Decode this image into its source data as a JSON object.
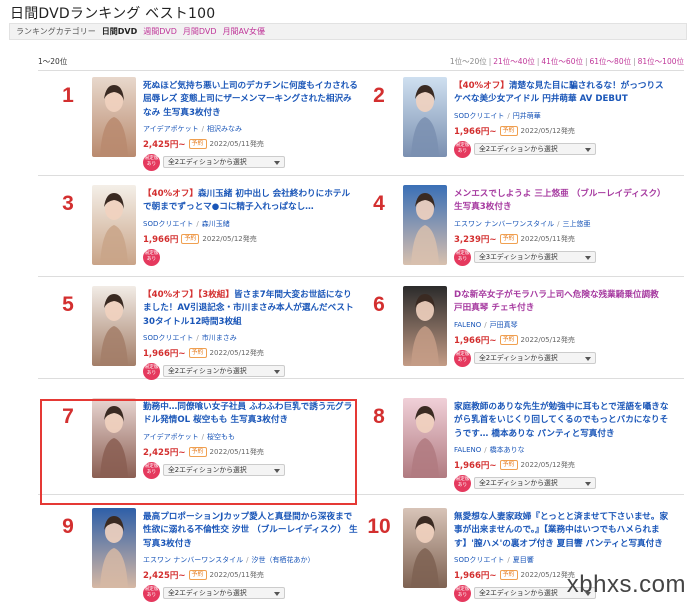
{
  "page": {
    "title": "日間DVDランキング ベスト100",
    "watermark": "xbhxs.com"
  },
  "categories": {
    "label": "ランキングカテゴリー",
    "active": "日間DVD",
    "links": [
      "週間DVD",
      "月間DVD",
      "月間AV女優"
    ]
  },
  "ranges": {
    "current": "1〜20位",
    "links": [
      "1位〜20位",
      "21位〜40位",
      "41位〜60位",
      "61位〜80位",
      "81位〜100位"
    ]
  },
  "common": {
    "edition_label": "全2エディションから選択",
    "edition_label_3": "全3エディションから選択",
    "badge": "限定版あり",
    "yoyaku": "予約"
  },
  "items": [
    {
      "rank": "1",
      "discount": "",
      "title": "死ぬほど気持ち悪い上司のデカチンに何度もイカされる屈辱レズ 変態上司にザーメンマーキングされた相沢みなみ 生写真3枚付き",
      "maker": "アイデアポケット",
      "actress": "相沢みなみ",
      "price": "2,425円~",
      "release": "2022/05/11発売",
      "edition": "全2エディションから選択",
      "cover_colors": [
        "#e8d8cc",
        "#b98a6e"
      ]
    },
    {
      "rank": "2",
      "discount": "【40%オフ】",
      "title": "清楚な見た目に騙されるな！がっつりスケベな美少女アイドル 円井萌華 AV DEBUT",
      "maker": "SODクリエイト",
      "actress": "円井萌華",
      "price": "1,966円~",
      "release": "2022/05/12発売",
      "edition": "全2エディションから選択",
      "cover_colors": [
        "#cfe0f0",
        "#7a8fb0"
      ]
    },
    {
      "rank": "3",
      "discount": "【40%オフ】",
      "title": "森川玉緒 初中出し 会社終わりにホテルで朝までずっとマ●コに精子入れっぱなし…",
      "maker": "SODクリエイト",
      "actress": "森川玉緒",
      "price": "1,966円",
      "release": "2022/05/12発売",
      "edition": "",
      "cover_colors": [
        "#f4efe8",
        "#c9a488"
      ]
    },
    {
      "rank": "4",
      "discount": "",
      "title": "メンエスでしようよ 三上悠亜 （ブルーレイディスク） 生写真3枚付き",
      "maker": "エスワン ナンバーワンスタイル",
      "actress": "三上悠亜",
      "price": "3,239円~",
      "release": "2022/05/11発売",
      "edition": "全3エディションから選択",
      "cover_colors": [
        "#3a6fb6",
        "#d8c0ae"
      ]
    },
    {
      "rank": "5",
      "discount": "【40%オフ】【3枚組】",
      "title": "皆さま7年間大変お世話になりました！AV引退記念・市川まさみ本人が選んだベスト30タイトル12時間3枚組",
      "maker": "SODクリエイト",
      "actress": "市川まさみ",
      "price": "1,966円~",
      "release": "2022/05/12発売",
      "edition": "全2エディションから選択",
      "cover_colors": [
        "#f2ece6",
        "#a37e68"
      ]
    },
    {
      "rank": "6",
      "discount": "",
      "title": "Dな新卒女子がモラハラ上司へ危険な残業騎乗位調教 戸田真琴 チェキ付き",
      "maker": "FALENO",
      "actress": "戸田真琴",
      "price": "1,966円~",
      "release": "2022/05/12発売",
      "edition": "全2エディションから選択",
      "cover_colors": [
        "#2b2b2b",
        "#c49c86"
      ]
    },
    {
      "rank": "7",
      "discount": "",
      "title": "勤務中…同僚喰い女子社員 ふわふわ巨乳で誘う元グラドル発情OL 桜空もも 生写真3枚付き",
      "maker": "アイデアポケット",
      "actress": "桜空もも",
      "price": "2,425円~",
      "release": "2022/05/11発売",
      "edition": "全2エディションから選択",
      "cover_colors": [
        "#e9d6d2",
        "#8a5e52"
      ]
    },
    {
      "rank": "8",
      "discount": "",
      "title": "家庭教師のありな先生が勉強中に耳もとで淫語を囁きながら乳首をいじくり回してくるのでもっとバカになりそうです… 橋本ありな パンティと写真付き",
      "maker": "FALENO",
      "actress": "橋本ありな",
      "price": "1,966円~",
      "release": "2022/05/12発売",
      "edition": "全2エディションから選択",
      "cover_colors": [
        "#f0d0d8",
        "#b07a80"
      ]
    },
    {
      "rank": "9",
      "discount": "",
      "title": "最高プロポーションJカップ愛人と真昼間から深夜まで性欲に溺れる不倫性交 汐世 （ブルーレイディスク） 生写真3枚付き",
      "maker": "エスワン ナンバーワンスタイル",
      "actress": "汐世（有栖花あか）",
      "price": "2,425円~",
      "release": "2022/05/11発売",
      "edition": "全2エディションから選択",
      "cover_colors": [
        "#2e5fa8",
        "#d6b8a4"
      ]
    },
    {
      "rank": "10",
      "discount": "",
      "title": "無愛想な人妻家政婦『とっとと済ませて下さいませ。家事が出来ませんので。』【業務中はいつでもハメられます】'膣ハメ'の裏オプ付き 夏目響 パンティと写真付き",
      "maker": "SODクリエイト",
      "actress": "夏目響",
      "price": "1,966円~",
      "release": "2022/05/12発売",
      "edition": "全2エディションから選択",
      "cover_colors": [
        "#d8c4b8",
        "#7e6252"
      ]
    }
  ],
  "colors": {
    "rank": "#d32f2f",
    "title_link": "#1a56b8",
    "accent_pink": "#c0389a",
    "badge": "#e5395e",
    "highlight_border": "#e53935"
  }
}
